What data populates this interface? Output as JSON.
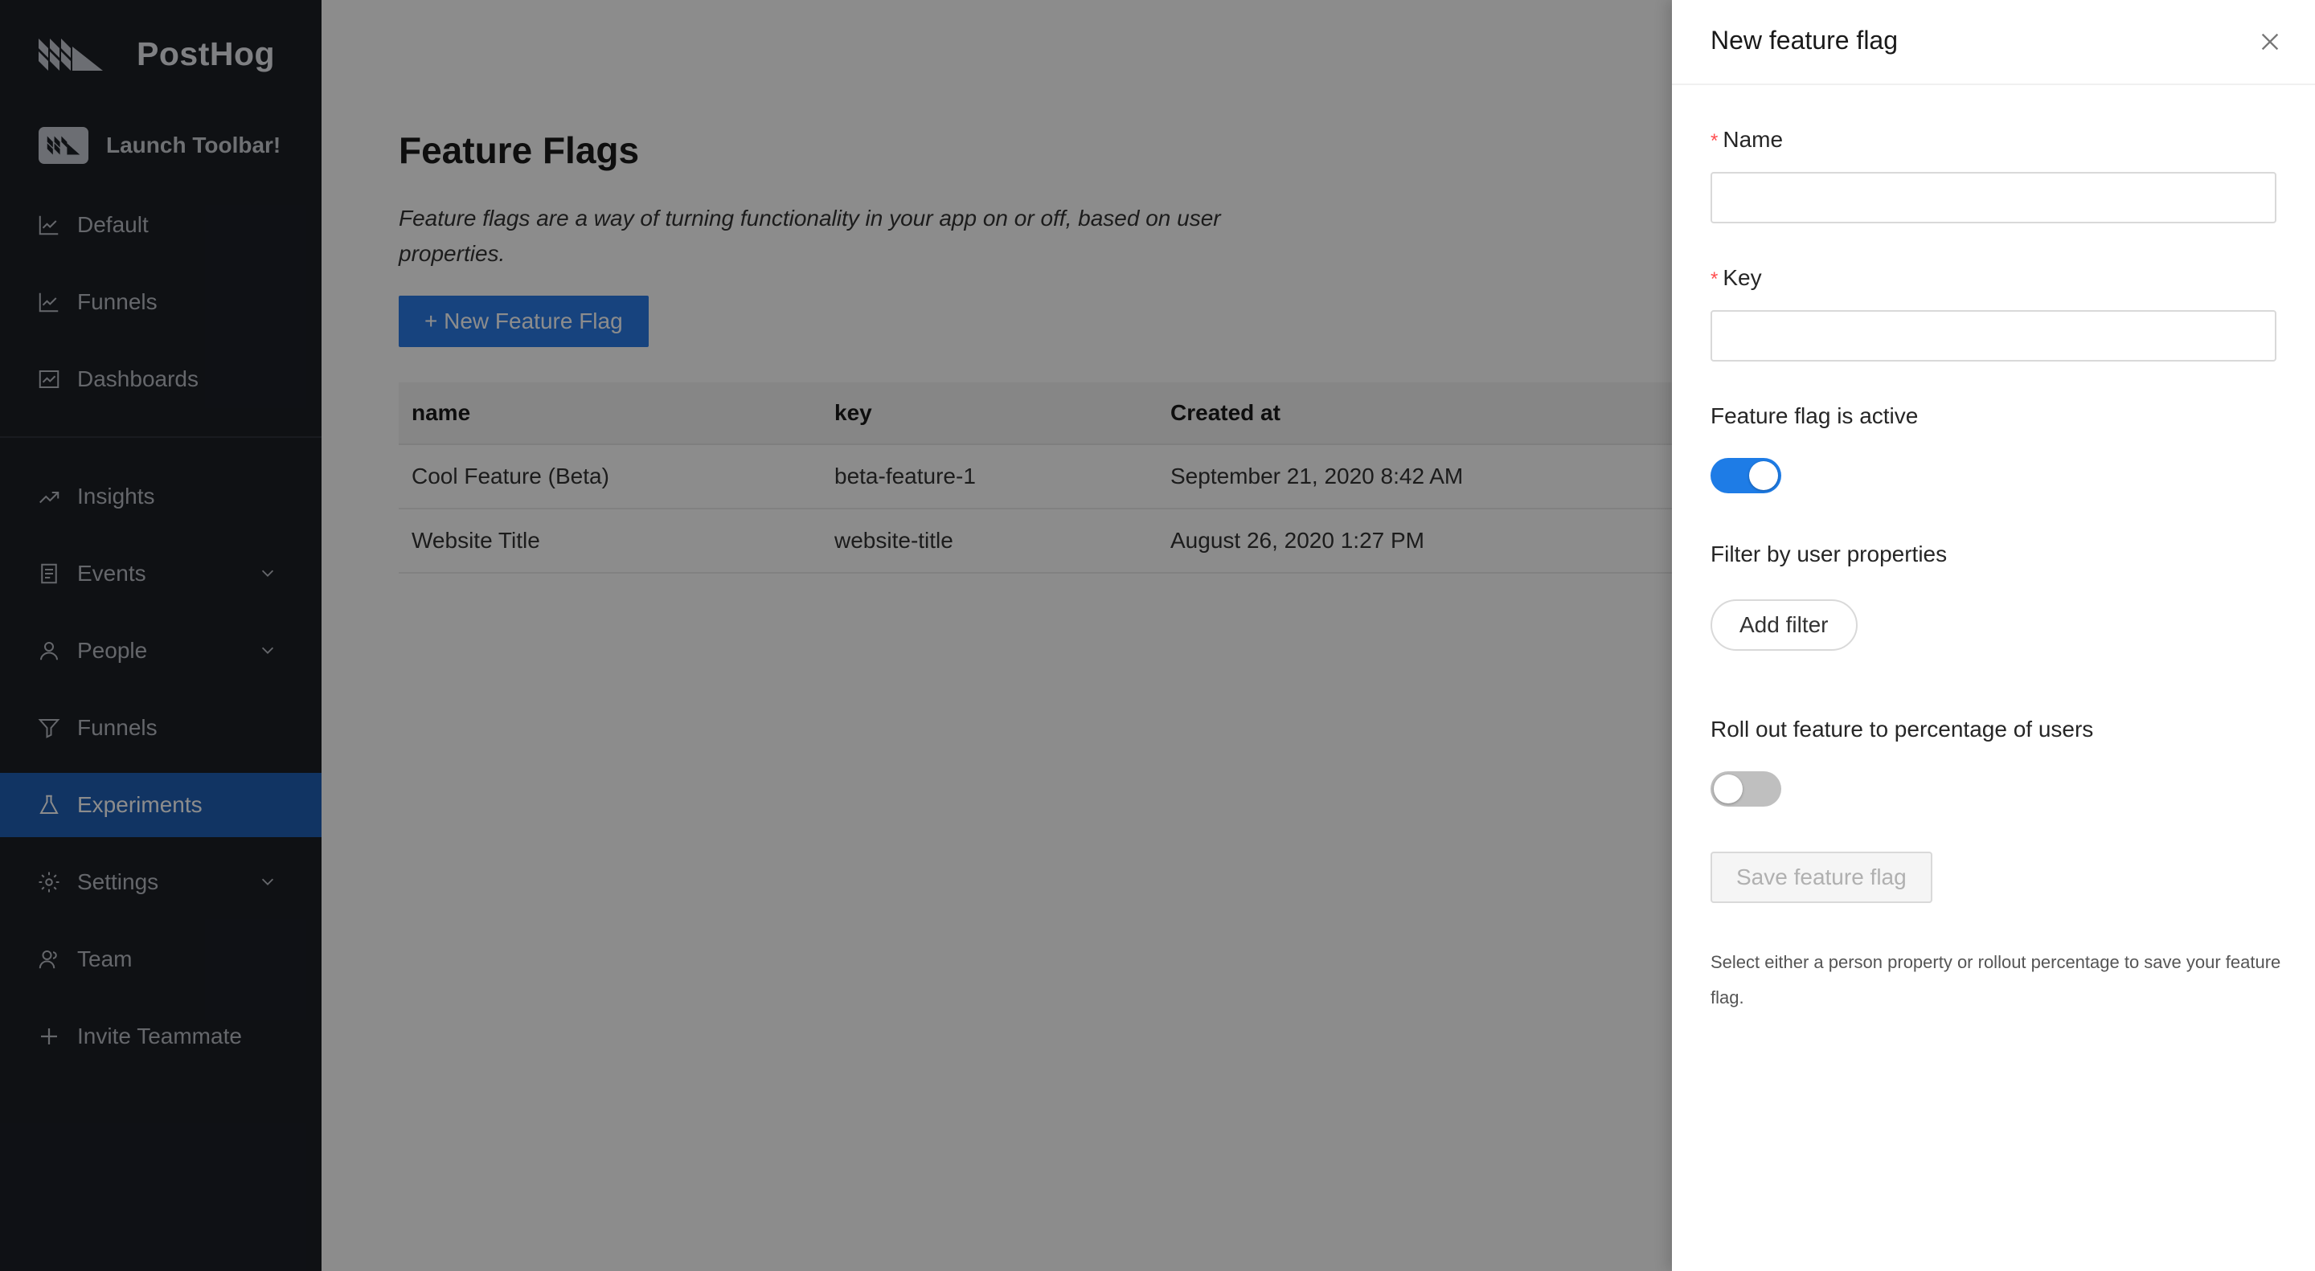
{
  "sidebar": {
    "brand": "PostHog",
    "toolbar_label": "Launch Toolbar!",
    "items": [
      {
        "label": "Default",
        "icon": "line-chart-icon"
      },
      {
        "label": "Funnels",
        "icon": "line-chart-icon"
      },
      {
        "label": "Dashboards",
        "icon": "dashboard-icon"
      },
      {
        "label": "Insights",
        "icon": "rise-icon"
      },
      {
        "label": "Events",
        "icon": "container-icon",
        "expandable": true
      },
      {
        "label": "People",
        "icon": "user-icon",
        "expandable": true
      },
      {
        "label": "Funnels",
        "icon": "funnel-icon"
      },
      {
        "label": "Experiments",
        "icon": "experiment-icon",
        "active": true
      },
      {
        "label": "Settings",
        "icon": "gear-icon",
        "expandable": true
      },
      {
        "label": "Team",
        "icon": "team-icon"
      },
      {
        "label": "Invite Teammate",
        "icon": "plus-icon"
      }
    ]
  },
  "main": {
    "title": "Feature Flags",
    "description": "Feature flags are a way of turning functionality in your app on or off, based on user properties.",
    "new_button": "+ New Feature Flag",
    "table": {
      "headers": [
        "name",
        "key",
        "Created at"
      ],
      "rows": [
        [
          "Cool Feature (Beta)",
          "beta-feature-1",
          "September 21, 2020 8:42 AM"
        ],
        [
          "Website Title",
          "website-title",
          "August 26, 2020 1:27 PM"
        ]
      ]
    }
  },
  "drawer": {
    "title": "New feature flag",
    "name_label": "Name",
    "name_value": "",
    "key_label": "Key",
    "key_value": "",
    "active_label": "Feature flag is active",
    "active_on": true,
    "filter_label": "Filter by user properties",
    "add_filter": "Add filter",
    "rollout_label": "Roll out feature to percentage of users",
    "rollout_on": false,
    "save_label": "Save feature flag",
    "help": "Select either a person property or rollout percentage to save your feature flag."
  },
  "colors": {
    "sidebar_bg": "#1c1f26",
    "active_nav": "#1f5fb5",
    "primary": "#2b7ae6",
    "toggle_on": "#1e7ce6"
  }
}
